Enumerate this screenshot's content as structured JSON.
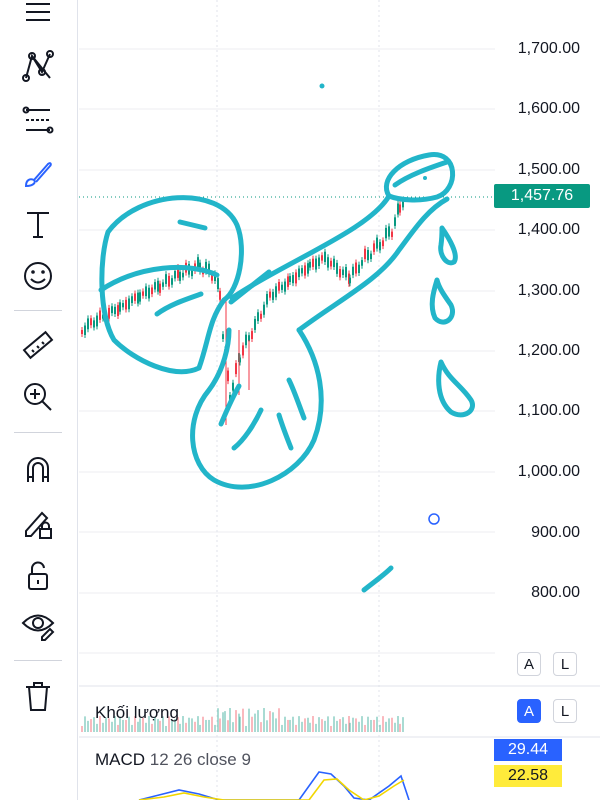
{
  "toolbar": {
    "tools": [
      {
        "name": "lines-icon"
      },
      {
        "name": "pattern-icon"
      },
      {
        "name": "fib-icon"
      },
      {
        "name": "brush-icon"
      },
      {
        "name": "text-icon"
      },
      {
        "name": "emoji-icon"
      },
      {
        "name": "ruler-icon"
      },
      {
        "name": "zoom-in-icon"
      },
      {
        "name": "magnet-icon"
      },
      {
        "name": "lock-draw-icon"
      },
      {
        "name": "lock-icon"
      },
      {
        "name": "eye-icon"
      },
      {
        "name": "trash-icon"
      }
    ],
    "active_color": "#2962ff"
  },
  "price_axis": {
    "labels": [
      "1,700.00",
      "1,600.00",
      "1,500.00",
      "1,400.00",
      "1,300.00",
      "1,200.00",
      "1,100.00",
      "1,000.00",
      "900.00",
      "800.00"
    ],
    "last_price": "1,457.76",
    "last_price_color": "#089981"
  },
  "buttons": {
    "auto": "A",
    "log": "L"
  },
  "volume_pane": {
    "title": "Khối lượng"
  },
  "macd_pane": {
    "title": "MACD",
    "params": "12 26 close 9",
    "macd_value": "29.44",
    "signal_value": "22.58",
    "macd_color": "#2962ff",
    "signal_color": "#ffeb3b"
  },
  "drawing": {
    "stroke_color": "#22b5c9"
  }
}
